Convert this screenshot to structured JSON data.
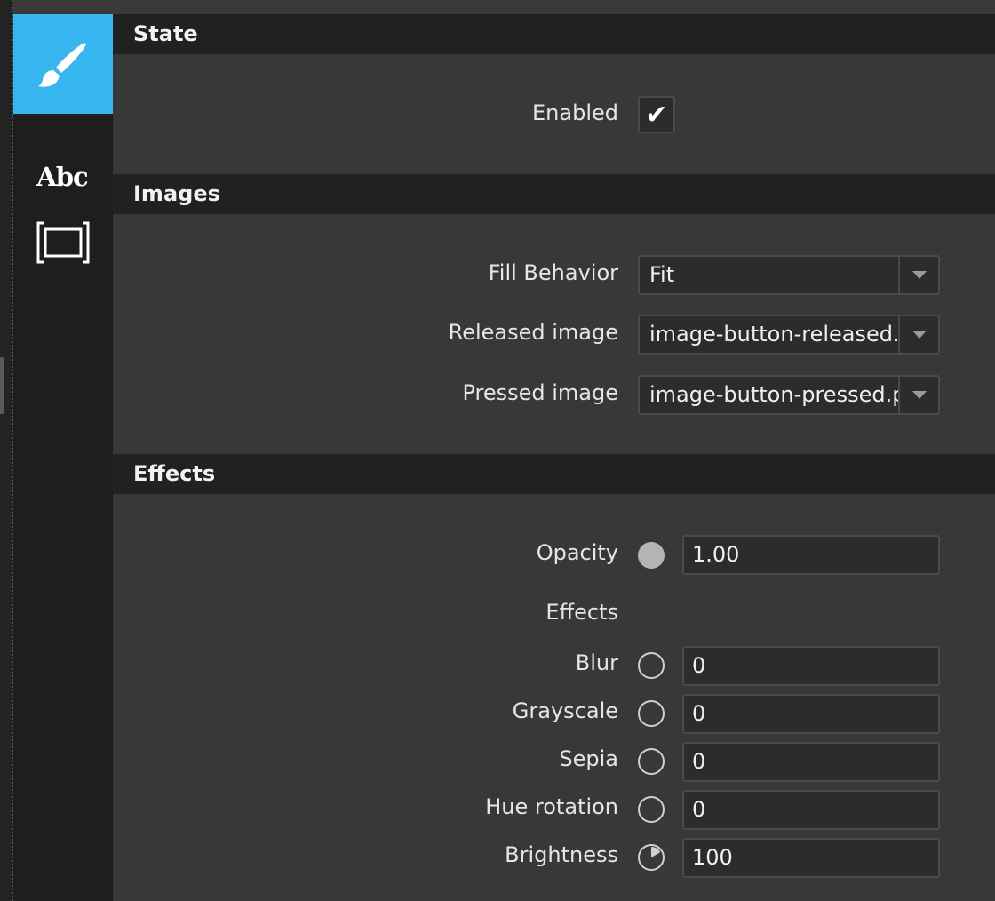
{
  "sidebar": {
    "tabs": [
      {
        "name": "style",
        "icon": "brush-icon",
        "active": true
      },
      {
        "name": "text",
        "icon": "abc-text-icon",
        "label": "Abc",
        "active": false
      },
      {
        "name": "layout",
        "icon": "frame-icon",
        "active": false
      }
    ]
  },
  "state": {
    "title": "State",
    "enabled_label": "Enabled",
    "enabled_checked": true,
    "check_glyph": "✔"
  },
  "images": {
    "title": "Images",
    "fill_behavior_label": "Fill Behavior",
    "fill_behavior_value": "Fit",
    "released_label": "Released image",
    "released_value": "image-button-released.png",
    "pressed_label": "Pressed image",
    "pressed_value": "image-button-pressed.png"
  },
  "effects": {
    "title": "Effects",
    "opacity_label": "Opacity",
    "opacity_value": "1.00",
    "effects_label": "Effects",
    "items": [
      {
        "label": "Blur",
        "value": "0"
      },
      {
        "label": "Grayscale",
        "value": "0"
      },
      {
        "label": "Sepia",
        "value": "0"
      },
      {
        "label": "Hue rotation",
        "value": "0"
      },
      {
        "label": "Brightness",
        "value": "100"
      }
    ]
  },
  "colors": {
    "accent": "#37b6f0",
    "header_bg": "#212121",
    "panel_bg": "#383838"
  }
}
